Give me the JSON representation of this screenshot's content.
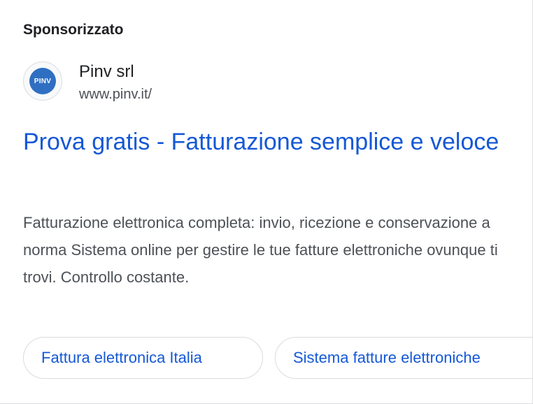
{
  "ad": {
    "sponsored_label": "Sponsorizzato",
    "logo_text": "PINV",
    "advertiser_name": "Pinv srl",
    "display_url": "www.pinv.it/",
    "headline": "Prova gratis - Fatturazione semplice e veloce",
    "description": "Fatturazione elettronica completa: invio, ricezione e conservazione a norma Sistema online per gestire le tue fatture elettroniche ovunque ti trovi. Controllo costante.",
    "sitelinks": [
      {
        "label": "Fattura elettronica Italia"
      },
      {
        "label": "Sistema fatture elettroniche"
      }
    ]
  },
  "colors": {
    "link": "#1558d6",
    "logo": "#2f6fc2",
    "text": "#202124",
    "muted": "#4d5156"
  }
}
